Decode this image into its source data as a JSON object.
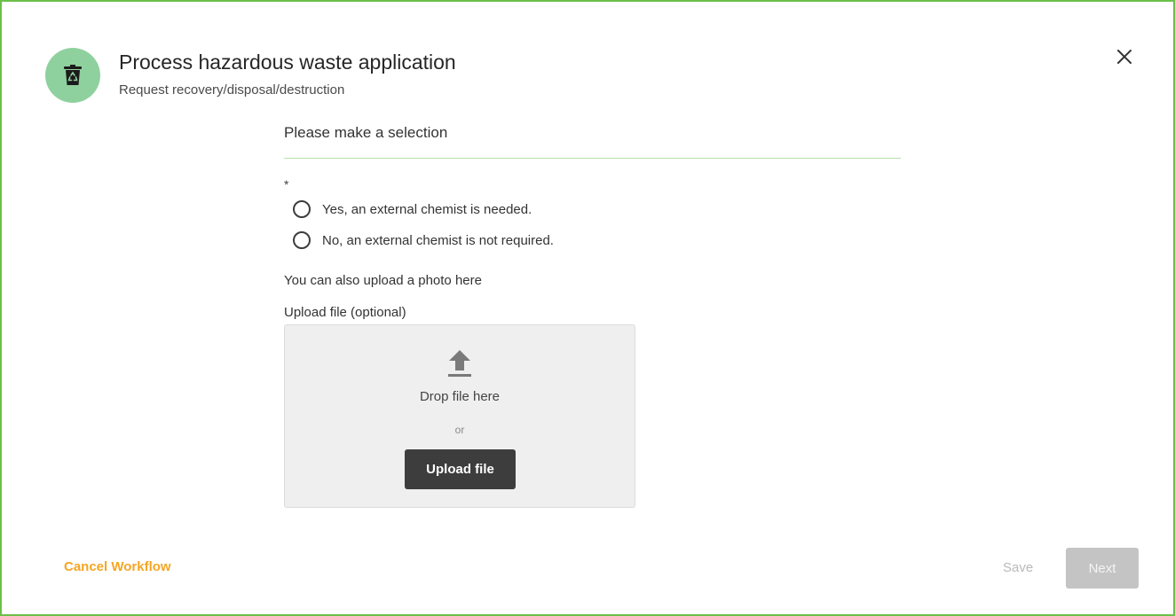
{
  "header": {
    "title": "Process hazardous waste application",
    "subtitle": "Request recovery/disposal/destruction",
    "icon": "recycle-bin-icon",
    "icon_bg_color": "#8fd19e",
    "close_icon": "close-icon"
  },
  "form": {
    "heading": "Please make a selection",
    "required_marker": "*",
    "options": [
      {
        "label": "Yes, an external chemist is needed.",
        "selected": false
      },
      {
        "label": "No, an external chemist is not required.",
        "selected": false
      }
    ],
    "helper_text": "You can also upload a photo here",
    "upload": {
      "label": "Upload file (optional)",
      "icon": "upload-icon",
      "drop_text": "Drop file here",
      "or_text": "or",
      "button_label": "Upload file"
    }
  },
  "footer": {
    "cancel_label": "Cancel Workflow",
    "save_label": "Save",
    "next_label": "Next"
  },
  "colors": {
    "accent_green": "#6cc04a",
    "cancel_orange": "#f5a623",
    "disabled_gray": "#c4c4c4"
  }
}
